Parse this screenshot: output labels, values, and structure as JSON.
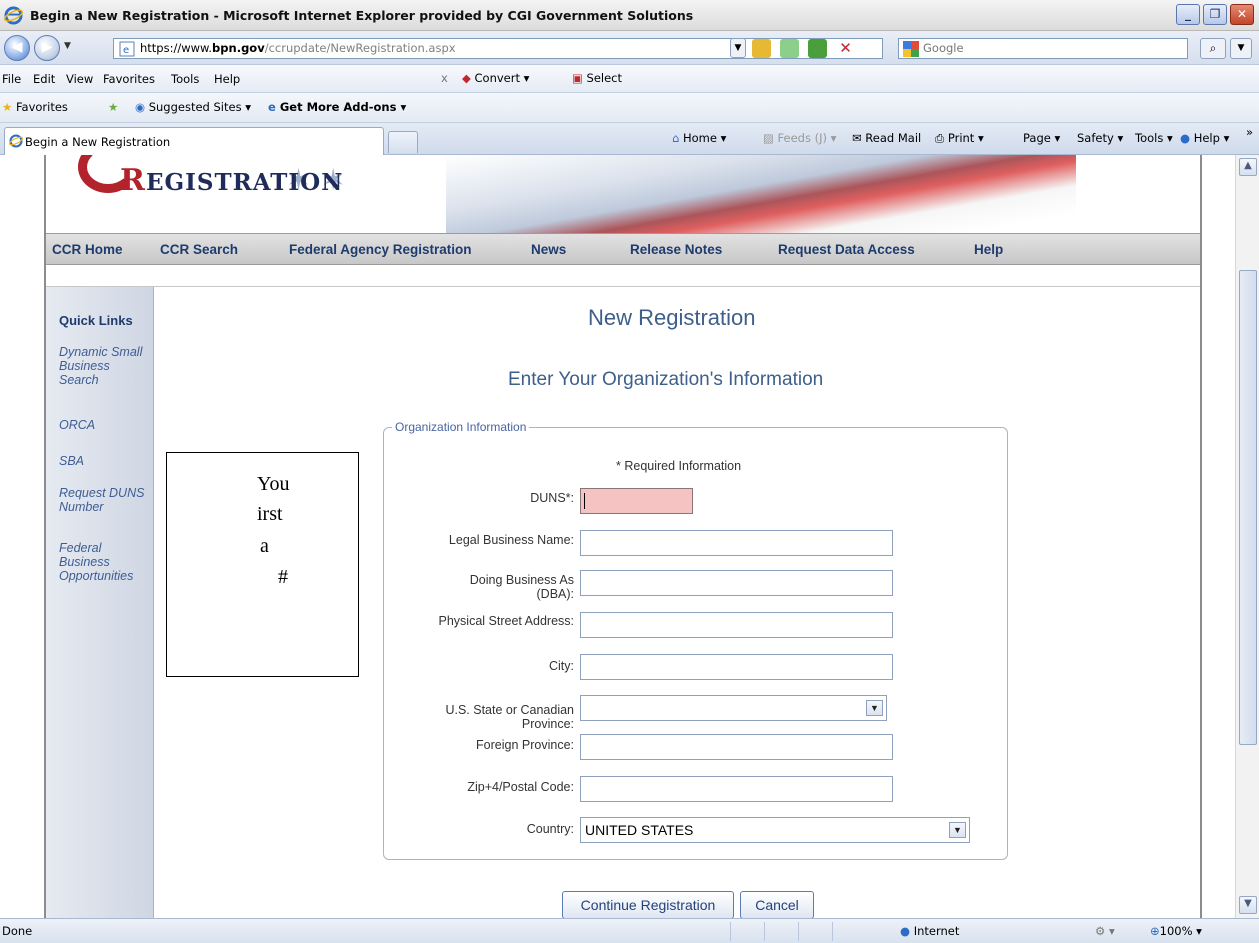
{
  "window": {
    "title": "Begin a New Registration - Microsoft Internet Explorer provided by CGI Government Solutions",
    "min_label": "_",
    "max_label": "❐",
    "close_label": "✕"
  },
  "address": {
    "url_protocol": "https://www.",
    "url_domain": "bpn.gov",
    "url_path": "/ccrupdate/NewRegistration.aspx",
    "search_placeholder": "Google"
  },
  "menu": {
    "items": [
      "File",
      "Edit",
      "View",
      "Favorites",
      "Tools",
      "Help"
    ],
    "close_x": "x",
    "convert": "Convert",
    "select": "Select"
  },
  "favorites_bar": {
    "favorites": "Favorites",
    "suggested": "Suggested Sites",
    "addons": "Get More Add-ons"
  },
  "tab": {
    "label": "Begin a New Registration"
  },
  "commands": {
    "home": "Home",
    "feeds": "Feeds (J)",
    "read_mail": "Read Mail",
    "print": "Print",
    "page": "Page",
    "safety": "Safety",
    "tools": "Tools",
    "help": "Help",
    "more": "»"
  },
  "site": {
    "brand": "REGISTRATION",
    "nav": [
      "CCR Home",
      "CCR Search",
      "Federal Agency Registration",
      "News",
      "Release Notes",
      "Request Data Access",
      "Help"
    ],
    "quick_links_title": "Quick Links",
    "quick_links": [
      "Dynamic Small Business Search",
      "ORCA",
      "SBA",
      "Request DUNS Number",
      "Federal Business Opportunities"
    ]
  },
  "content": {
    "heading": "New Registration",
    "subheading": "Enter Your Organization's Information",
    "overlay_lines": [
      "You",
      "irst",
      "a",
      "#"
    ],
    "fieldset_legend": "Organization Information",
    "required_note": "* Required Information",
    "fields": {
      "duns": "DUNS*:",
      "legal_name": "Legal Business Name:",
      "dba": "Doing Business As (DBA):",
      "street": "Physical Street Address:",
      "city": "City:",
      "state": "U.S. State or Canadian Province:",
      "foreign_province": "Foreign Province:",
      "zip": "Zip+4/Postal Code:",
      "country": "Country:"
    },
    "country_value": "UNITED STATES",
    "continue_button": "Continue Registration",
    "cancel_button": "Cancel"
  },
  "status": {
    "text": "Done",
    "zone": "Internet",
    "zoom": "100%"
  },
  "colors": {
    "duns_field_bg": "#f6c3c3",
    "link_blue": "#3d5d94",
    "heading_blue": "#3e5f8a"
  }
}
